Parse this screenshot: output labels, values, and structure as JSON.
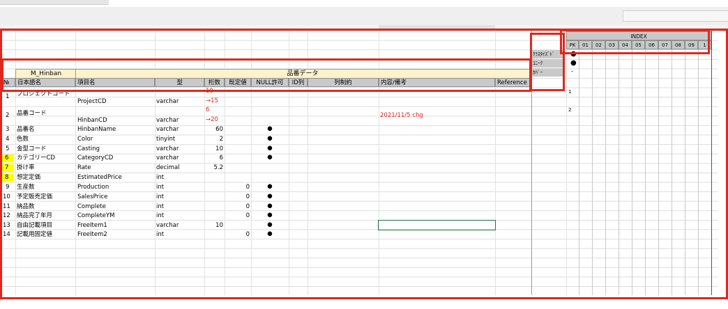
{
  "table": {
    "name": "M_Hinban",
    "caption": "品番データ",
    "headers": [
      "№",
      "日本語名",
      "項目名",
      "型",
      "桁数",
      "既定値",
      "NULL許可",
      "ID列",
      "列制約",
      "内容/備考",
      "Reference"
    ]
  },
  "index": {
    "title": "INDEX",
    "cols": [
      "PK",
      "01",
      "02",
      "03",
      "04",
      "05",
      "06",
      "07",
      "08",
      "09",
      "1"
    ],
    "labels": [
      "ｸﾗｽﾀｲｽﾞﾄﾞ",
      "ﾕﾆｰｸ",
      "ｶﾊﾞｰ"
    ],
    "pk_marks": [
      "●",
      "●",
      "-"
    ],
    "pk_row1": "1",
    "pk_row2": "2"
  },
  "rows": [
    {
      "no": "1",
      "jp": "プロジェクトコード",
      "field": "ProjectCD",
      "type": "varchar",
      "len_a": "10",
      "len_b": "→15",
      "def": "",
      "nul": "",
      "note": ""
    },
    {
      "no": "2",
      "jp": "品番コード",
      "field": "HinbanCD",
      "type": "varchar",
      "len_a": "6",
      "len_b": "→20",
      "def": "",
      "nul": "",
      "note": "2021/11/5 chg"
    },
    {
      "no": "3",
      "jp": "品番名",
      "field": "HinbanName",
      "type": "varchar",
      "len": "60",
      "def": "",
      "nul": "●",
      "note": ""
    },
    {
      "no": "4",
      "jp": "色数",
      "field": "Color",
      "type": "tinyint",
      "len": "2",
      "def": "",
      "nul": "●",
      "note": ""
    },
    {
      "no": "5",
      "jp": "金型コード",
      "field": "Casting",
      "type": "varchar",
      "len": "10",
      "def": "",
      "nul": "●",
      "note": ""
    },
    {
      "no": "6",
      "jp": "カテゴリーCD",
      "field": "CategoryCD",
      "type": "varchar",
      "len": "6",
      "def": "",
      "nul": "●",
      "note": ""
    },
    {
      "no": "7",
      "jp": "掛け率",
      "field": "Rate",
      "type": "decimal",
      "len": "5.2",
      "def": "",
      "nul": "",
      "note": ""
    },
    {
      "no": "8",
      "jp": "想定定価",
      "field": "EstimatedPrice",
      "type": "int",
      "len": "",
      "def": "",
      "nul": "",
      "note": ""
    },
    {
      "no": "9",
      "jp": "生産数",
      "field": "Production",
      "type": "int",
      "len": "",
      "def": "0",
      "nul": "●",
      "note": ""
    },
    {
      "no": "10",
      "jp": "予定販売定価",
      "field": "SalesPrice",
      "type": "int",
      "len": "",
      "def": "0",
      "nul": "●",
      "note": ""
    },
    {
      "no": "11",
      "jp": "納品数",
      "field": "Complete",
      "type": "int",
      "len": "",
      "def": "0",
      "nul": "●",
      "note": ""
    },
    {
      "no": "12",
      "jp": "納品完了年月",
      "field": "CompleteYM",
      "type": "int",
      "len": "",
      "def": "0",
      "nul": "●",
      "note": ""
    },
    {
      "no": "13",
      "jp": "自由記載項目",
      "field": "FreeItem1",
      "type": "varchar",
      "len": "10",
      "def": "",
      "nul": "●",
      "note": ""
    },
    {
      "no": "14",
      "jp": "記載用固定値",
      "field": "FreeItem2",
      "type": "int",
      "len": "",
      "def": "0",
      "nul": "●",
      "note": ""
    }
  ],
  "colors": {
    "header_fill": "#c9c9c9",
    "title_fill": "#fff2cc",
    "highlight": "#ffff00",
    "annotation_red": "#e0271e",
    "excel_green": "#217346"
  }
}
